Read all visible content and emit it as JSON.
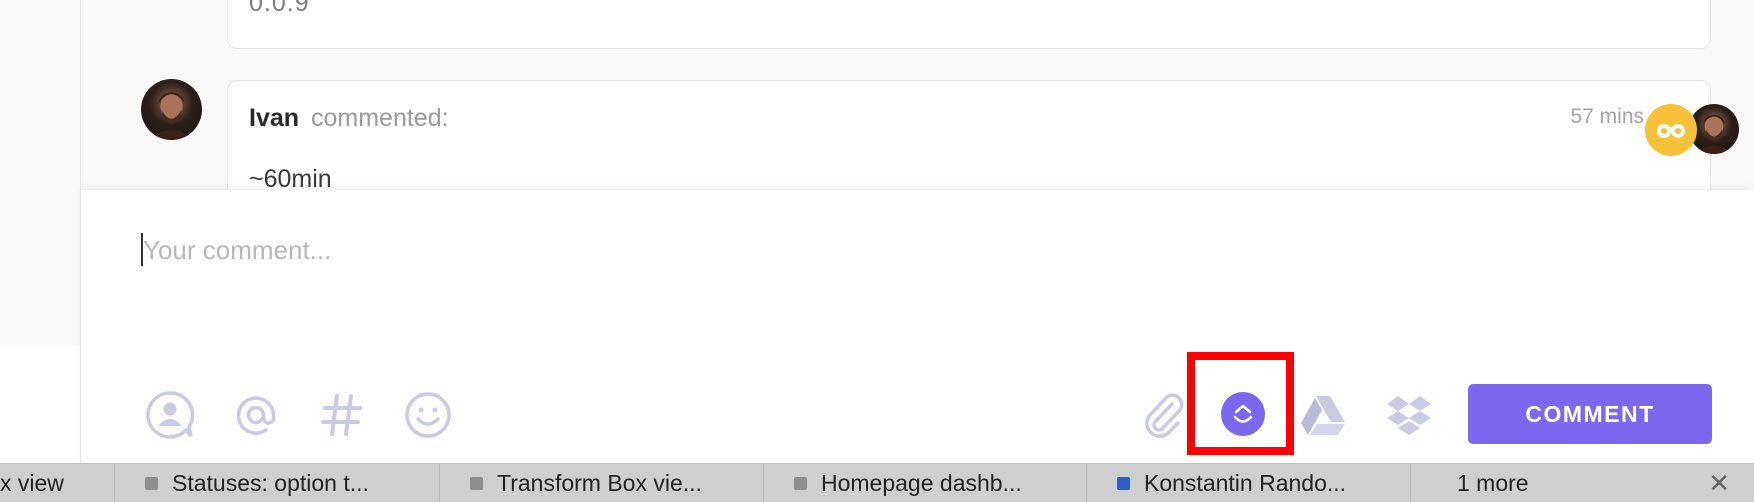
{
  "previous_comment": {
    "text": "0.0.9"
  },
  "comment": {
    "author": "Ivan",
    "action": "commented:",
    "time": "57 mins",
    "body": "~60min"
  },
  "composer": {
    "placeholder": "Your comment...",
    "submit_label": "COMMENT"
  },
  "toolbar": {
    "left_icons": [
      "assign-person-icon",
      "mention-icon",
      "hashtag-icon",
      "emoji-icon"
    ],
    "right_icons": [
      "attachment-icon",
      "clickup-icon",
      "google-drive-icon",
      "dropbox-icon"
    ]
  },
  "tabs": [
    {
      "title": "x view"
    },
    {
      "title": "Statuses: option t..."
    },
    {
      "title": "Transform Box vie..."
    },
    {
      "title": "Homepage dashb..."
    },
    {
      "title": "Konstantin Rando..."
    },
    {
      "title": "1 more"
    }
  ],
  "colors": {
    "accent": "#7b68ee",
    "highlight": "#ff0000",
    "viewer_badge": "#f7c13a",
    "icon_gray": "#c9cbe3"
  }
}
